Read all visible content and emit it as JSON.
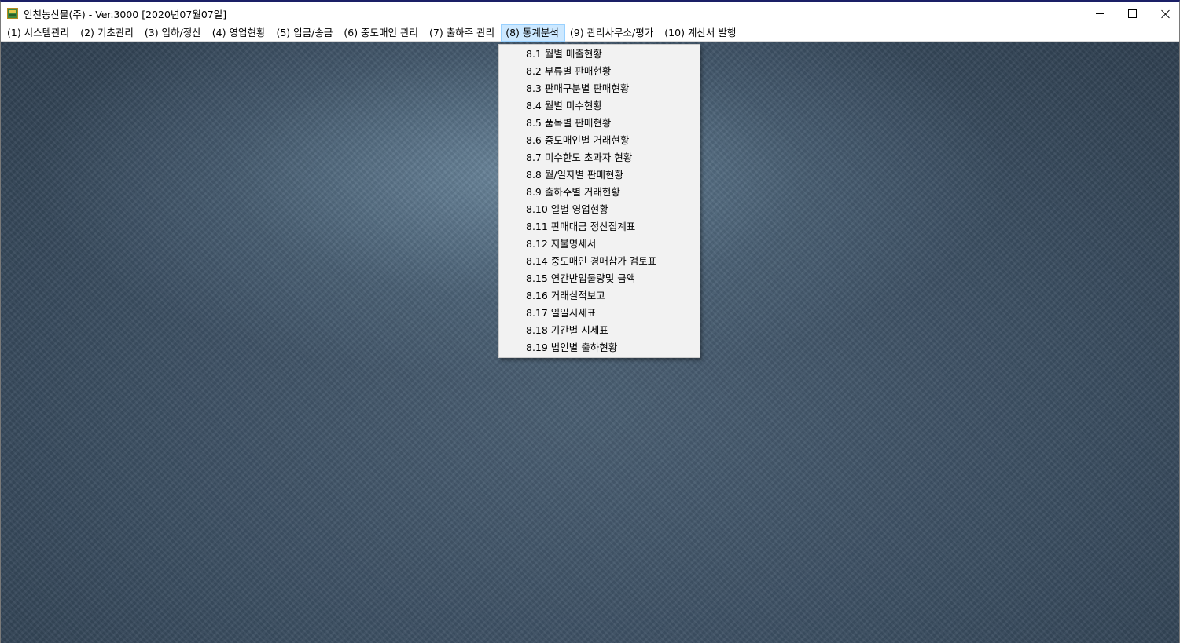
{
  "window": {
    "title": "인천농산물(주) - Ver.3000 [2020년07월07일]"
  },
  "menubar": {
    "items": [
      {
        "label": "(1) 시스템관리"
      },
      {
        "label": "(2) 기초관리"
      },
      {
        "label": "(3) 입하/정산"
      },
      {
        "label": "(4) 영업현황"
      },
      {
        "label": "(5) 입금/송금"
      },
      {
        "label": "(6) 중도매인 관리"
      },
      {
        "label": "(7) 출하주 관리"
      },
      {
        "label": "(8) 통계분석",
        "active": true
      },
      {
        "label": "(9) 관리사무소/평가"
      },
      {
        "label": "(10) 계산서 발행"
      }
    ]
  },
  "dropdown": {
    "items": [
      {
        "label": "8.1 월별 매출현황"
      },
      {
        "label": "8.2 부류별 판매현황"
      },
      {
        "label": "8.3 판매구분별 판매현황"
      },
      {
        "label": "8.4 월별 미수현황"
      },
      {
        "label": "8.5 품목별 판매현황"
      },
      {
        "label": "8.6 중도매인별 거래현황"
      },
      {
        "label": "8.7 미수한도 초과자 현황"
      },
      {
        "label": "8.8 월/일자별 판매현황"
      },
      {
        "label": "8.9 출하주별 거래현황"
      },
      {
        "label": "8.10 일별 영업현황"
      },
      {
        "label": "8.11 판매대금 정산집계표"
      },
      {
        "label": "8.12 지불명세서"
      },
      {
        "label": "8.14 중도매인 경매참가 검토표"
      },
      {
        "label": "8.15 연간반입물량및 금액"
      },
      {
        "label": "8.16 거래실적보고"
      },
      {
        "label": "8.17 일일시세표"
      },
      {
        "label": "8.18 기간별 시세표"
      },
      {
        "label": "8.19 법인별 출하현황"
      }
    ]
  },
  "colors": {
    "title_accent": "#1a1f66",
    "menu_active_bg": "#cce8ff",
    "menu_active_border": "#99d1ff",
    "dropdown_bg": "#f2f2f2",
    "desktop_bg": "#3a4d60"
  },
  "icons": {
    "app": "app-icon",
    "minimize": "minimize-icon",
    "maximize": "maximize-icon",
    "close": "close-icon"
  }
}
